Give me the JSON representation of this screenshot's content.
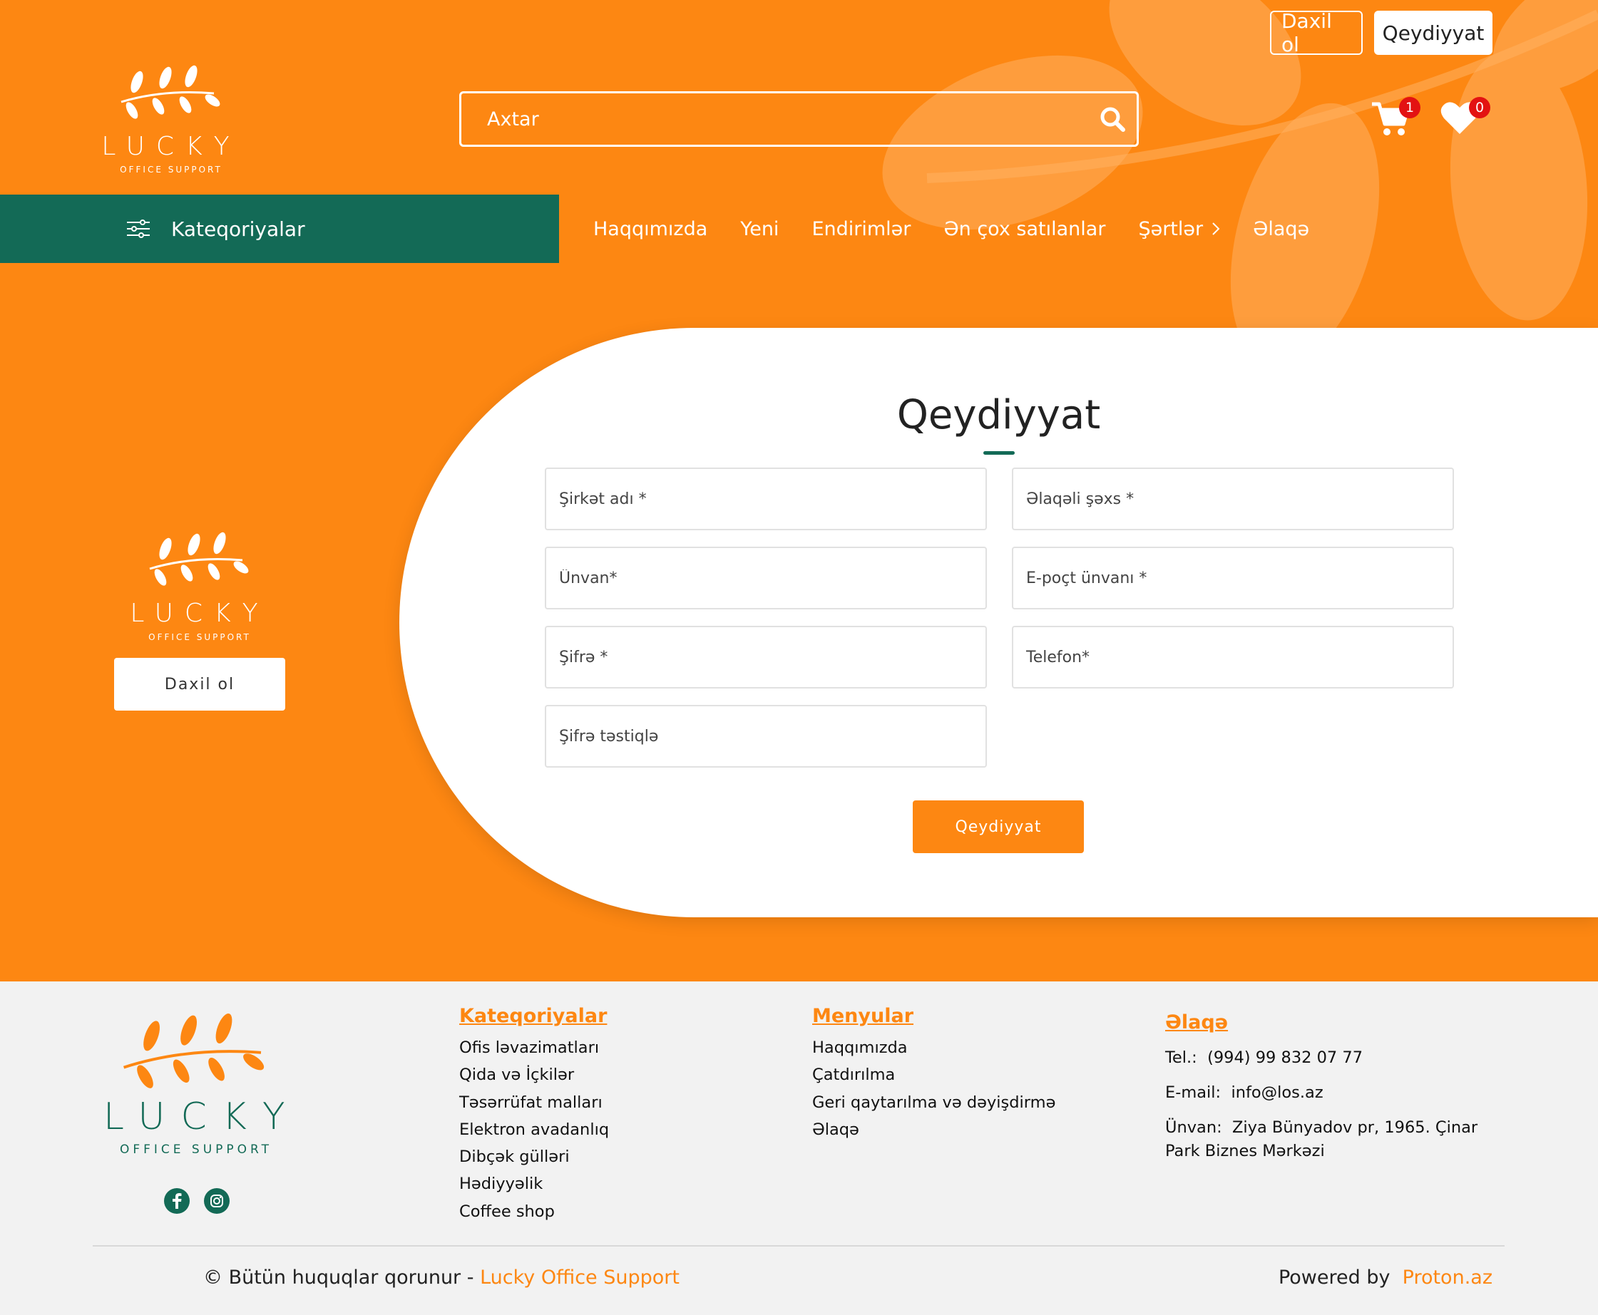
{
  "colors": {
    "brand_orange": "#fd8712",
    "brand_green": "#136a56",
    "badge_red": "#e31212",
    "footer_bg": "#f2f2f2"
  },
  "header": {
    "logo_text": "LUCKY",
    "logo_sub": "OFFICE SUPPORT",
    "login_label": "Daxil ol",
    "register_label": "Qeydiyyat",
    "search_placeholder": "Axtar",
    "cart_count": "1",
    "wishlist_count": "0",
    "categories_label": "Kateqoriyalar",
    "nav": [
      "Haqqımızda",
      "Yeni",
      "Endirimlər",
      "Ən çox satılanlar",
      "Şərtlər",
      "Əlaqə"
    ]
  },
  "form": {
    "title": "Qeydiyyat",
    "fields": {
      "company": "Şirkət adı *",
      "contact_person": "Əlaqəli şəxs *",
      "address": "Ünvan*",
      "email": "E-poçt ünvanı *",
      "password": "Şifrə *",
      "phone": "Telefon*",
      "password_confirm": "Şifrə təstiqlə"
    },
    "submit_label": "Qeydiyyat",
    "side_login_label": "Daxil ol"
  },
  "footer": {
    "categories_title": "Kateqoriyalar",
    "categories": [
      "Ofis ləvazimatları",
      "Qida və İçkilər",
      "Təsərrüfat malları",
      "Elektron avadanlıq",
      "Dibçək gülləri",
      "Hədiyyəlik",
      "Coffee shop"
    ],
    "menus_title": "Menyular",
    "menus": [
      "Haqqımızda",
      "Çatdırılma",
      "Geri qaytarılma və dəyişdirmə",
      "Əlaqə"
    ],
    "contact_title": "Əlaqə",
    "tel_label": "Tel.:",
    "tel_value": "(994) 99 832 07 77",
    "email_label": "E-mail:",
    "email_value": "info@los.az",
    "address_label": "Ünvan:",
    "address_value": "Ziya Bünyadov pr, 1965. Çinar Park Biznes Mərkəzi",
    "copyright_text": "© Bütün huquqlar qorunur -",
    "copyright_brand": "Lucky Office Support",
    "powered_text": "Powered by",
    "powered_brand": "Proton.az"
  }
}
